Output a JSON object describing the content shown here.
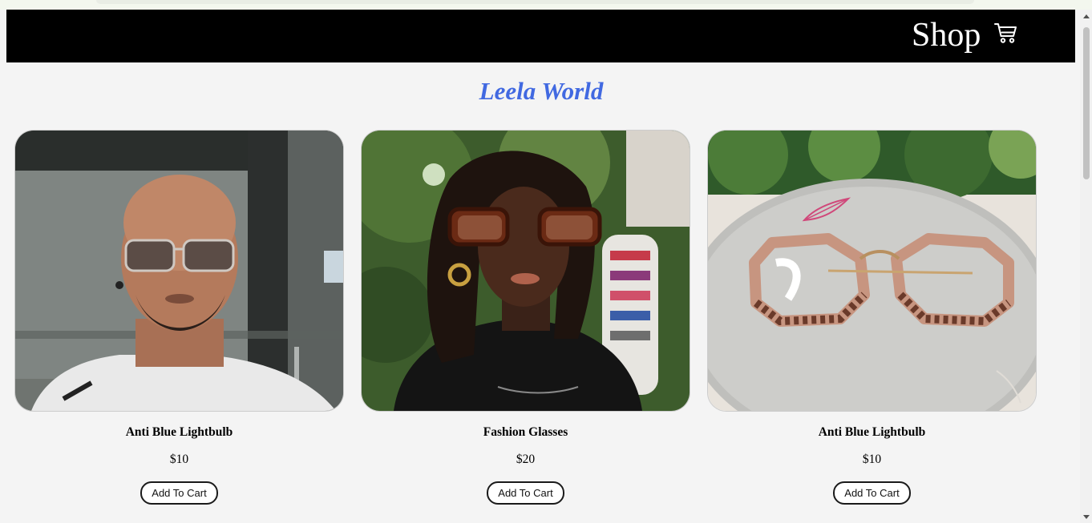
{
  "header": {
    "title": "Shop",
    "cart_icon": "shopping-cart-icon"
  },
  "brand": {
    "name": "Leela World",
    "color": "#4169e1"
  },
  "products": [
    {
      "name": "Anti Blue Lightbulb",
      "price": "$10",
      "button_label": "Add To Cart",
      "image": "man-wearing-sunglasses-photo"
    },
    {
      "name": "Fashion Glasses",
      "price": "$20",
      "button_label": "Add To Cart",
      "image": "woman-wearing-cat-eye-glasses-photo"
    },
    {
      "name": "Anti Blue Lightbulb",
      "price": "$10",
      "button_label": "Add To Cart",
      "image": "pink-hexagon-glasses-photo"
    }
  ]
}
